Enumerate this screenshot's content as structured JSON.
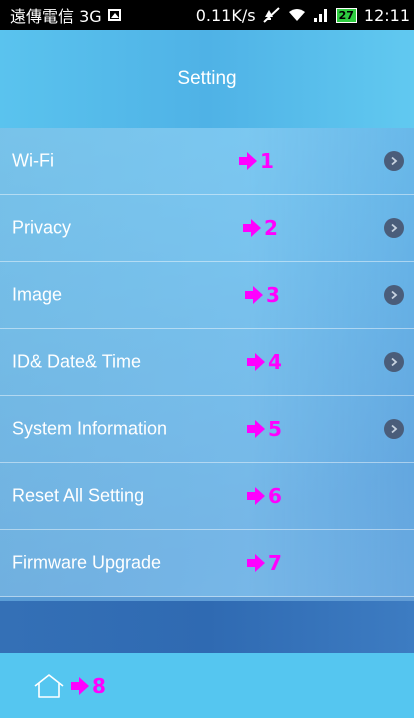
{
  "status_bar": {
    "carrier": "遠傳電信 3G",
    "speed": "0.11K/s",
    "battery": "27",
    "time": "12:11"
  },
  "header": {
    "title": "Setting"
  },
  "menu": [
    {
      "label": "Wi-Fi",
      "marker": "1",
      "has_chevron": true
    },
    {
      "label": "Privacy",
      "marker": "2",
      "has_chevron": true
    },
    {
      "label": "Image",
      "marker": "3",
      "has_chevron": true
    },
    {
      "label": "ID& Date& Time",
      "marker": "4",
      "has_chevron": true
    },
    {
      "label": "System Information",
      "marker": "5",
      "has_chevron": true
    },
    {
      "label": "Reset All Setting",
      "marker": "6",
      "has_chevron": false
    },
    {
      "label": "Firmware Upgrade",
      "marker": "7",
      "has_chevron": false
    }
  ],
  "bottom_bar": {
    "home_marker": "8"
  },
  "icons": {
    "status": [
      "image-icon",
      "mute-icon",
      "wifi-icon",
      "signal-icon",
      "battery-icon"
    ],
    "home": "home-icon",
    "chevron": "chevron-right-icon",
    "marker": "arrow-right-icon"
  },
  "colors": {
    "marker": "#ff00ff",
    "header": "#55c2ee",
    "bottom_bar": "#55c6f0",
    "band": "#3470b6"
  }
}
